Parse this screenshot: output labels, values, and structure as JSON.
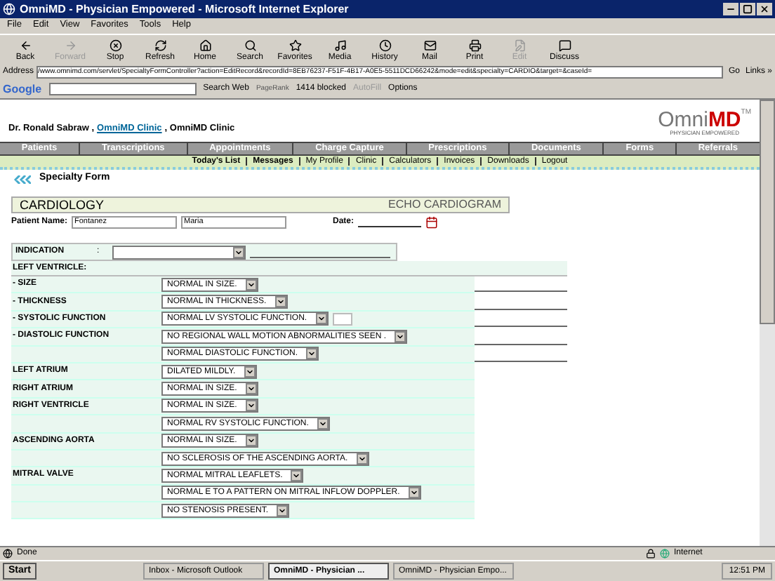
{
  "window": {
    "title": "OmniMD - Physician Empowered - Microsoft Internet Explorer"
  },
  "menu": [
    "File",
    "Edit",
    "View",
    "Favorites",
    "Tools",
    "Help"
  ],
  "toolbar": [
    {
      "label": "Back",
      "kind": "back",
      "disabled": false
    },
    {
      "label": "Forward",
      "kind": "forward",
      "disabled": true
    },
    {
      "label": "Stop",
      "kind": "stop",
      "disabled": false
    },
    {
      "label": "Refresh",
      "kind": "refresh",
      "disabled": false
    },
    {
      "label": "Home",
      "kind": "home",
      "disabled": false
    },
    {
      "label": "Search",
      "kind": "search",
      "disabled": false
    },
    {
      "label": "Favorites",
      "kind": "favorites",
      "disabled": false
    },
    {
      "label": "Media",
      "kind": "media",
      "disabled": false
    },
    {
      "label": "History",
      "kind": "history",
      "disabled": false
    },
    {
      "label": "Mail",
      "kind": "mail",
      "disabled": false
    },
    {
      "label": "Print",
      "kind": "print",
      "disabled": false
    },
    {
      "label": "Edit",
      "kind": "edit",
      "disabled": true
    },
    {
      "label": "Discuss",
      "kind": "discuss",
      "disabled": false
    }
  ],
  "address": {
    "label": "Address",
    "url": "/www.omnimd.com/servlet/SpecialtyFormController?action=EditRecord&recordId=8EB76237-F51F-4B17-A0E5-5511DCD66242&mode=edit&specialty=CARDIO&target=&caseId=",
    "go": "Go",
    "links": "Links »"
  },
  "google_bar": {
    "logo": "Google",
    "search": "Search Web",
    "pagerank": "PageRank",
    "blocked": "1414 blocked",
    "autofill": "AutoFill",
    "options": "Options"
  },
  "header": {
    "doctor": "Dr. Ronald Sabraw ,",
    "clinic_link": "OmniMD Clinic",
    "clinic": ", OmniMD Clinic",
    "logo_a": "Omni",
    "logo_b": "MD",
    "logo_tm": "TM",
    "tagline": "PHYSICIAN EMPOWERED"
  },
  "nav": [
    "Patients",
    "Transcriptions",
    "Appointments",
    "Charge Capture",
    "Prescriptions",
    "Documents",
    "Forms",
    "Referrals"
  ],
  "subnav": [
    {
      "label": "Today's List",
      "emphasized": true
    },
    {
      "label": "Messages",
      "emphasized": true
    },
    {
      "label": "My Profile",
      "emphasized": false
    },
    {
      "label": "Clinic",
      "emphasized": false
    },
    {
      "label": "Calculators",
      "emphasized": false
    },
    {
      "label": "Invoices",
      "emphasized": false
    },
    {
      "label": "Downloads",
      "emphasized": false
    },
    {
      "label": "Logout",
      "emphasized": false
    }
  ],
  "page_title": "Specialty Form",
  "form": {
    "specialty": "CARDIOLOGY",
    "study": "ECHO CARDIOGRAM",
    "patient_label": "Patient Name:",
    "last_name": "Fontanez",
    "first_name": "Maria",
    "date_label": "Date:",
    "indication_label": "INDICATION",
    "indication_colon": ":",
    "section": "LEFT VENTRICLE:",
    "rows": [
      {
        "label": "- SIZE",
        "selects": [
          {
            "value": "NORMAL IN SIZE.",
            "note_field": true
          }
        ]
      },
      {
        "label": "- THICKNESS",
        "selects": [
          {
            "value": "NORMAL IN THICKNESS.",
            "note_field": true
          }
        ]
      },
      {
        "label": "- SYSTOLIC FUNCTION",
        "selects": [
          {
            "value": "NORMAL LV SYSTOLIC FUNCTION.",
            "note_field": true,
            "extra_box": true
          }
        ]
      },
      {
        "label": "- DIASTOLIC FUNCTION",
        "selects": [
          {
            "value": "NO REGIONAL WALL MOTION ABNORMALITIES SEEN .",
            "note_field": true
          },
          {
            "value": "NORMAL DIASTOLIC FUNCTION.",
            "note_field": true
          }
        ]
      },
      {
        "label": "LEFT ATRIUM",
        "selects": [
          {
            "value": "DILATED MILDLY.",
            "note_field": false
          }
        ]
      },
      {
        "label": "RIGHT ATRIUM",
        "selects": [
          {
            "value": "NORMAL IN SIZE.",
            "note_field": false
          }
        ]
      },
      {
        "label": "RIGHT VENTRICLE",
        "selects": [
          {
            "value": "NORMAL IN SIZE.",
            "note_field": false
          },
          {
            "value": "NORMAL RV SYSTOLIC FUNCTION.",
            "note_field": false
          }
        ]
      },
      {
        "label": "ASCENDING AORTA",
        "selects": [
          {
            "value": "NORMAL IN SIZE.",
            "note_field": false
          },
          {
            "value": "NO SCLEROSIS OF THE ASCENDING AORTA.",
            "note_field": false
          }
        ]
      },
      {
        "label": "MITRAL VALVE",
        "selects": [
          {
            "value": "NORMAL MITRAL LEAFLETS.",
            "note_field": false
          },
          {
            "value": "NORMAL E TO A PATTERN ON MITRAL INFLOW DOPPLER.",
            "note_field": false
          },
          {
            "value": "NO STENOSIS PRESENT.",
            "note_field": false
          }
        ]
      }
    ]
  },
  "status_bar": {
    "text": "Done",
    "zone": "Internet"
  },
  "taskbar": {
    "start": "Start",
    "tasks": [
      {
        "label": "Inbox - Microsoft Outlook",
        "selected": false
      },
      {
        "label": "OmniMD - Physician ...",
        "selected": true
      },
      {
        "label": "OmniMD - Physician Empo...",
        "selected": false
      }
    ],
    "clock": "12:51 PM"
  }
}
